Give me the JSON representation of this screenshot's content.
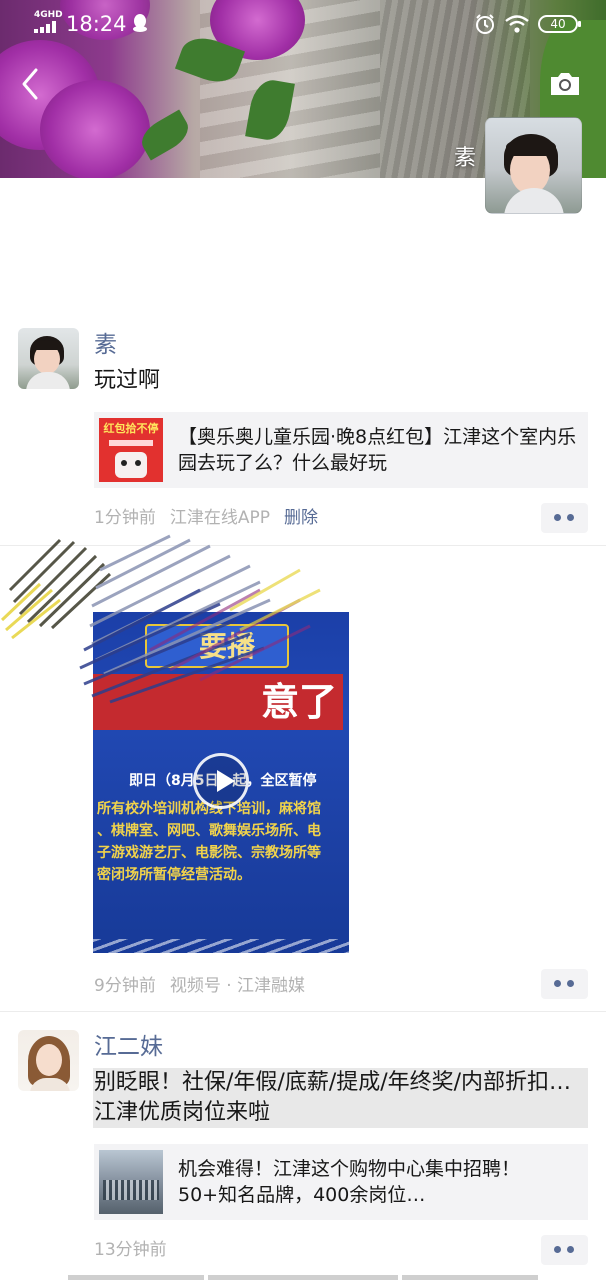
{
  "status_bar": {
    "network": "4GHD",
    "time": "18:24",
    "battery": "40"
  },
  "nav": {
    "back_icon": "chevron-left-icon",
    "camera_icon": "camera-icon"
  },
  "profile": {
    "name": "素"
  },
  "posts": [
    {
      "author": "素",
      "text": "玩过啊",
      "share": {
        "thumb_label": "红包拾不停",
        "text": "【奥乐奥儿童乐园·晚8点红包】江津这个室内乐园去玩了么？什么最好玩"
      },
      "time": "1分钟前",
      "source": "江津在线APP",
      "delete_label": "删除"
    },
    {
      "video": {
        "top_label": "要播",
        "headline": "意了",
        "lines": [
          "即日（8月5日）起，全区暂停",
          "所有校外培训机构线下培训，麻将馆",
          "、棋牌室、网吧、歌舞娱乐场所、电",
          "子游戏游艺厅、电影院、宗教场所等",
          "密闭场所暂停经营活动。"
        ]
      },
      "time": "9分钟前",
      "source": "视频号 · 江津融媒"
    },
    {
      "author": "江二妹",
      "text": "别眨眼！社保/年假/底薪/提成/年终奖/内部折扣…江津优质岗位来啦",
      "share": {
        "text": "机会难得！江津这个购物中心集中招聘！50+知名品牌，400余岗位…"
      },
      "time": "13分钟前"
    }
  ],
  "colors": {
    "link": "#576b95",
    "meta": "#b2b2b2",
    "share_bg": "#f3f3f5"
  }
}
